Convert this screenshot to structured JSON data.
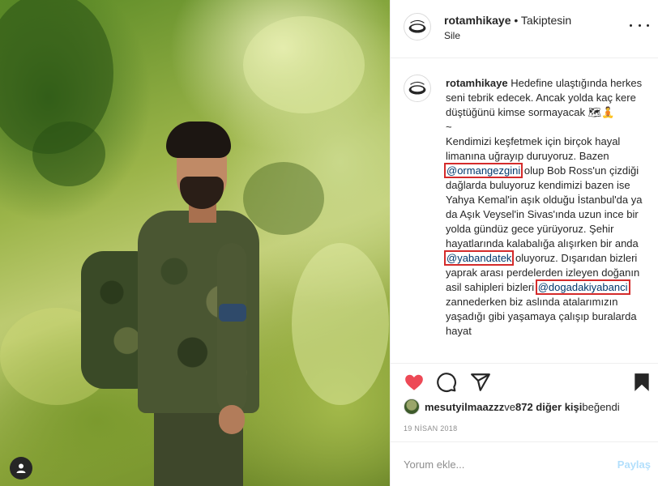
{
  "post": {
    "account": {
      "username": "rotamhikaye",
      "separator": " • ",
      "follow_state": "Takiptesin",
      "sub_action": "Sile"
    },
    "caption": {
      "username": "rotamhikaye",
      "line1": " Hedefine ulaştığında herkes seni tebrik edecek. Ancak yolda kaç kere düştüğünü kimse sormayacak 🗺🧘",
      "line2": "~",
      "para_a": "Kendimizi keşfetmek için birçok hayal limanına uğrayıp duruyoruz. Bazen ",
      "mention1": "@ormangezgini",
      "para_b": " olup Bob Ross'un çizdiği dağlarda buluyoruz kendimizi bazen ise Yahya Kemal'in aşık olduğu İstanbul'da ya da Aşık Veysel'in Sivas'ında uzun ince bir yolda gündüz gece yürüyoruz. Şehir hayatlarında kalabalığa alışırken bir anda ",
      "mention2": "@yabandatek",
      "para_c": " oluyoruz. Dışarıdan bizleri yaprak arası perdelerden izleyen doğanın asil sahipleri bizleri ",
      "mention3": "@dogadakiyabanci",
      "para_d": " zannederken biz aslında atalarımızın yaşadığı gibi yaşamaya çalışıp buralarda hayat"
    },
    "likes": {
      "user": "mesutyilmaazzz",
      "connector": " ve ",
      "others": "872 diğer kişi",
      "suffix": " beğendi"
    },
    "date": "19 NİSAN 2018",
    "comment": {
      "placeholder": "Yorum ekle...",
      "post_label": "Paylaş"
    }
  },
  "icons": {
    "like": "heart-icon-filled",
    "comment": "comment-icon",
    "share": "share-icon",
    "save": "bookmark-icon-filled",
    "more": "more-icon",
    "user_tag": "user-icon"
  },
  "colors": {
    "like_red": "#ed4956",
    "mention_blue": "#00376b",
    "highlight_box": "#d42b2b",
    "post_button_disabled": "#b2dffc",
    "muted_text": "#8e8e8e"
  }
}
